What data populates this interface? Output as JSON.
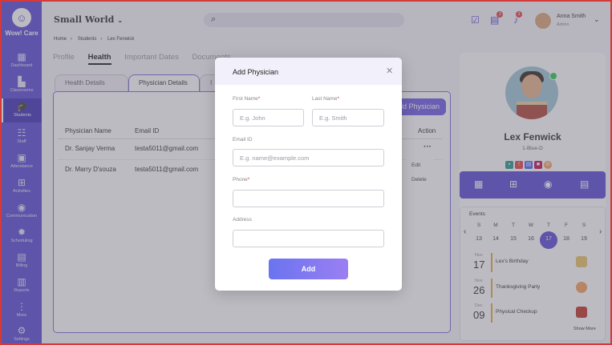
{
  "app": {
    "logo_text": "Wow! Care",
    "logo_mark": "☺"
  },
  "sidebar": {
    "items": [
      {
        "label": "Dashboard",
        "icon": "calendar-icon"
      },
      {
        "label": "Classrooms",
        "icon": "building-icon"
      },
      {
        "label": "Students",
        "icon": "graduation-cap-icon"
      },
      {
        "label": "Staff",
        "icon": "people-icon"
      },
      {
        "label": "Attendance",
        "icon": "calendar-check-icon"
      },
      {
        "label": "Activities",
        "icon": "grid-plus-icon"
      },
      {
        "label": "Communication",
        "icon": "chat-icon"
      },
      {
        "label": "Scheduling",
        "icon": "gear-icon"
      },
      {
        "label": "Billing",
        "icon": "document-icon"
      },
      {
        "label": "Reports",
        "icon": "report-icon"
      },
      {
        "label": "More",
        "icon": "more-vertical-icon"
      },
      {
        "label": "Settings",
        "icon": "settings-icon"
      }
    ],
    "active": "Students"
  },
  "topbar": {
    "school_name": "Small World",
    "user": {
      "name": "Anna Smith",
      "role": "Admin"
    },
    "badges": {
      "messages": "3",
      "notifications": "3"
    }
  },
  "breadcrumb": [
    "Home",
    "Students",
    "Lex Fenwick"
  ],
  "profile_tabs": [
    "Profile",
    "Health",
    "Important Dates",
    "Documents"
  ],
  "active_profile_tab": "Health",
  "health_tabs": [
    "Health Details",
    "Physician Details",
    "I"
  ],
  "active_health_tab": "Physician Details",
  "add_physician_label": "Add Physician",
  "table": {
    "headers": [
      "Physician Name",
      "Email ID",
      "Action"
    ],
    "rows": [
      {
        "name": "Dr. Sanjay Verma",
        "email": "testa5011@gmail.com"
      },
      {
        "name": "Dr. Marry D'souza",
        "email": "testa5011@gmail.com"
      }
    ],
    "row_menu": [
      "Edit",
      "Delete"
    ]
  },
  "student": {
    "name": "Lex Fenwick",
    "class": "1-Blue-D",
    "events_title": "Events",
    "week_days": [
      "S",
      "M",
      "T",
      "W",
      "T",
      "F",
      "S"
    ],
    "week_dates": [
      "13",
      "14",
      "15",
      "16",
      "17",
      "18",
      "19"
    ],
    "selected_date": "17",
    "events": [
      {
        "month": "Nov",
        "day": "17",
        "name": "Lex's Birthday"
      },
      {
        "month": "Nov",
        "day": "26",
        "name": "Thanksgiving Party"
      },
      {
        "month": "Dec",
        "day": "09",
        "name": "Physical Checkup"
      }
    ],
    "show_more": "Show More"
  },
  "modal": {
    "title": "Add Physician",
    "first_name": {
      "label": "First Name",
      "placeholder": "E.g. John"
    },
    "last_name": {
      "label": "Last Name",
      "placeholder": "E.g. Smith"
    },
    "email": {
      "label": "Email ID",
      "placeholder": "E.g. name@example.com"
    },
    "phone": {
      "label": "Phone",
      "placeholder": ""
    },
    "address": {
      "label": "Address",
      "placeholder": ""
    },
    "required_mark": "*",
    "submit_label": "Add"
  },
  "colors": {
    "primary": "#5c4fd6",
    "accent_gradient_start": "#6a74f0",
    "accent_gradient_end": "#9b7ff2",
    "frame_border": "#d43a3a"
  }
}
